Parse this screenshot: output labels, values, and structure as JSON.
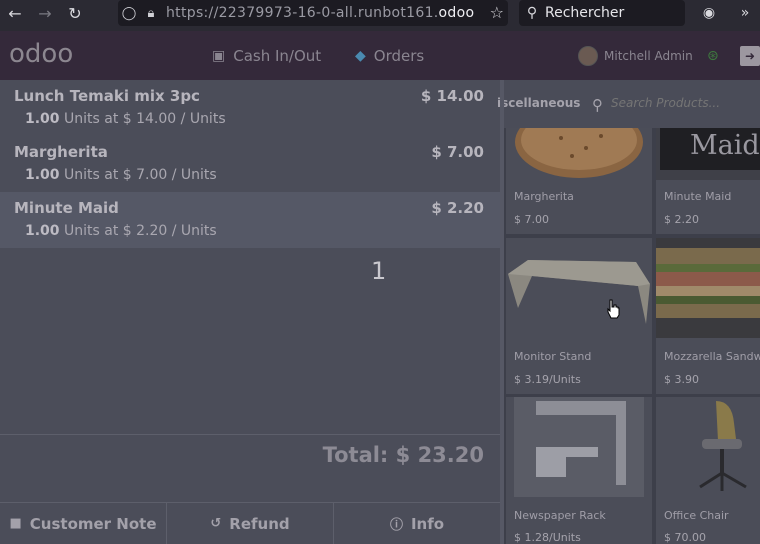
{
  "browser": {
    "url_main": "https://22379973-16-0-all.runbot161.",
    "url_host": "odoo",
    "search_label": "Rechercher"
  },
  "header": {
    "logo": "odoo",
    "cash_label": "Cash In/Out",
    "orders_label": "Orders",
    "user_name": "Mitchell Admin"
  },
  "order": {
    "lines": [
      {
        "name": "Lunch Temaki mix 3pc",
        "price": "$ 14.00",
        "qty": "1.00",
        "detail": "Units at $ 14.00 / Units"
      },
      {
        "name": "Margherita",
        "price": "$ 7.00",
        "qty": "1.00",
        "detail": "Units at $ 7.00 / Units"
      },
      {
        "name": "Minute Maid",
        "price": "$ 2.20",
        "qty": "1.00",
        "detail": "Units at $ 2.20 / Units"
      }
    ],
    "numpad_buffer": "1",
    "total": "Total: $ 23.20"
  },
  "controls": {
    "customer_note": "Customer Note",
    "refund": "Refund",
    "info": "Info"
  },
  "products": {
    "category": "iscellaneous",
    "search_placeholder": "Search Products...",
    "items": [
      {
        "name": "Margherita",
        "price": "$ 7.00"
      },
      {
        "name": "Minute Maid",
        "price": "$ 2.20",
        "image_text": "Maid"
      },
      {
        "name": "Monitor Stand",
        "price": "$ 3.19/Units"
      },
      {
        "name": "Mozzarella Sandwich",
        "price": "$ 3.90"
      },
      {
        "name": "Newspaper Rack",
        "price": "$ 1.28/Units"
      },
      {
        "name": "Office Chair",
        "price": "$ 70.00"
      }
    ]
  },
  "colors": {
    "header_bg": "#34293a",
    "order_bg": "#4b4d59",
    "selected_line": "#555866"
  }
}
